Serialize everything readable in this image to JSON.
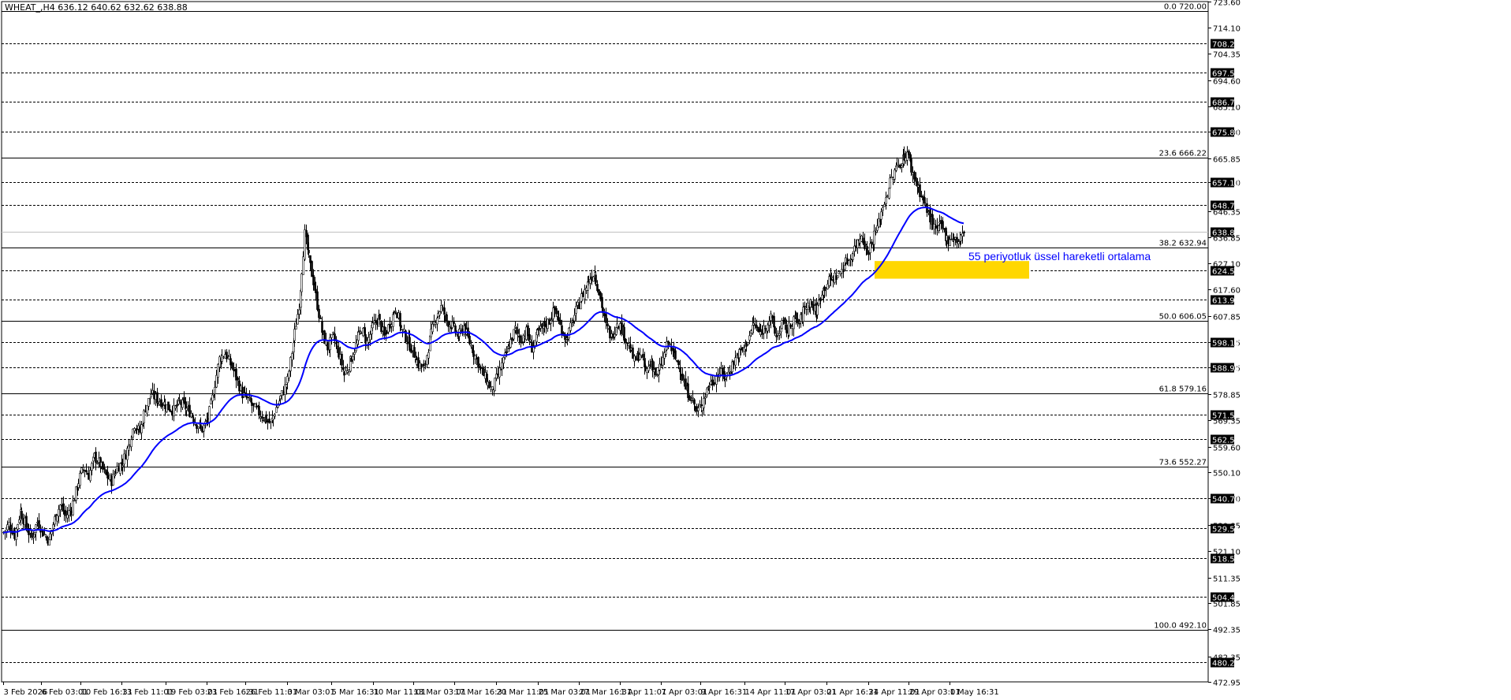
{
  "chart_data": {
    "type": "candlestick",
    "title": "WHEAT_,H4  636.12 640.62 632.62 638.88",
    "ylim": [
      472.95,
      723.6
    ],
    "y_ticks": [
      "723.60",
      "714.10",
      "704.35",
      "694.60",
      "685.10",
      "675.80",
      "665.85",
      "657.10",
      "646.35",
      "636.85",
      "627.10",
      "617.60",
      "607.85",
      "598.15",
      "588.95",
      "578.85",
      "569.35",
      "559.60",
      "550.10",
      "540.70",
      "530.85",
      "521.10",
      "511.35",
      "501.85",
      "492.35",
      "482.35",
      "472.95"
    ],
    "x_ticks": [
      "3 Feb 2026",
      "6 Feb 03:01",
      "10 Feb 16:31",
      "13 Feb 11:01",
      "19 Feb 03:01",
      "23 Feb 16:31",
      "26 Feb 11:01",
      "3 Mar 03:01",
      "5 Mar 16:31",
      "10 Mar 11:01",
      "13 Mar 03:01",
      "17 Mar 16:31",
      "20 Mar 11:01",
      "25 Mar 03:01",
      "27 Mar 16:31",
      "1 Apr 11:01",
      "7 Apr 03:01",
      "9 Apr 16:31",
      "14 Apr 11:01",
      "17 Apr 03:01",
      "21 Apr 16:31",
      "24 Apr 11:01",
      "29 Apr 03:01",
      "1 May 16:31"
    ],
    "horizontal_levels": [
      {
        "label": "708.20",
        "value": 708.2,
        "style": "dashed"
      },
      {
        "label": "697.50",
        "value": 697.5,
        "style": "dashed"
      },
      {
        "label": "686.75",
        "value": 686.75,
        "style": "dashed"
      },
      {
        "label": "675.80",
        "value": 675.8,
        "style": "dashed"
      },
      {
        "label": "657.10",
        "value": 657.1,
        "style": "dashed"
      },
      {
        "label": "648.75",
        "value": 648.75,
        "style": "dashed"
      },
      {
        "label": "638.88",
        "value": 638.88,
        "style": "solid"
      },
      {
        "label": "624.55",
        "value": 624.55,
        "style": "dashed"
      },
      {
        "label": "613.95",
        "value": 613.95,
        "style": "dashed"
      },
      {
        "label": "598.15",
        "value": 598.15,
        "style": "dashed"
      },
      {
        "label": "588.95",
        "value": 588.95,
        "style": "dashed"
      },
      {
        "label": "571.50",
        "value": 571.5,
        "style": "dashed"
      },
      {
        "label": "562.55",
        "value": 562.55,
        "style": "dashed"
      },
      {
        "label": "540.70",
        "value": 540.7,
        "style": "dashed"
      },
      {
        "label": "529.55",
        "value": 529.55,
        "style": "dashed"
      },
      {
        "label": "518.50",
        "value": 518.5,
        "style": "dashed"
      },
      {
        "label": "504.40",
        "value": 504.4,
        "style": "dashed"
      },
      {
        "label": "480.20",
        "value": 480.2,
        "style": "dashed"
      }
    ],
    "fib_levels": [
      {
        "label": "0.0 720.00",
        "value": 720.0
      },
      {
        "label": "23.6 666.22",
        "value": 666.22
      },
      {
        "label": "38.2 632.94",
        "value": 632.94
      },
      {
        "label": "50.0 606.05",
        "value": 606.05
      },
      {
        "label": "61.8 579.16",
        "value": 579.16
      },
      {
        "label": "73.6 552.27",
        "value": 552.27
      },
      {
        "label": "100.0 492.10",
        "value": 492.1
      }
    ],
    "ema_annotation": "55 periyotluk üssel hareketli ortalama",
    "ema_color": "#0000ff",
    "zone": {
      "from": 621.5,
      "to": 628.0,
      "color": "#ffd700"
    },
    "close_path": [
      [
        0,
        528
      ],
      [
        4,
        531
      ],
      [
        8,
        527
      ],
      [
        12,
        536
      ],
      [
        16,
        530
      ],
      [
        20,
        526
      ],
      [
        24,
        532
      ],
      [
        28,
        528
      ],
      [
        32,
        525
      ],
      [
        36,
        533
      ],
      [
        40,
        538
      ],
      [
        44,
        534
      ],
      [
        48,
        537
      ],
      [
        52,
        545
      ],
      [
        56,
        552
      ],
      [
        60,
        549
      ],
      [
        64,
        556
      ],
      [
        68,
        553
      ],
      [
        72,
        549
      ],
      [
        76,
        547
      ],
      [
        80,
        552
      ],
      [
        84,
        554
      ],
      [
        88,
        560
      ],
      [
        92,
        568
      ],
      [
        96,
        565
      ],
      [
        100,
        574
      ],
      [
        104,
        579
      ],
      [
        108,
        577
      ],
      [
        112,
        576
      ],
      [
        116,
        574
      ],
      [
        120,
        573
      ],
      [
        124,
        576
      ],
      [
        128,
        574
      ],
      [
        132,
        572
      ],
      [
        136,
        568
      ],
      [
        140,
        566
      ],
      [
        144,
        570
      ],
      [
        148,
        580
      ],
      [
        152,
        592
      ],
      [
        156,
        594
      ],
      [
        160,
        590
      ],
      [
        164,
        585
      ],
      [
        168,
        579
      ],
      [
        172,
        577
      ],
      [
        176,
        574
      ],
      [
        180,
        572
      ],
      [
        184,
        570
      ],
      [
        188,
        568
      ],
      [
        192,
        574
      ],
      [
        196,
        579
      ],
      [
        200,
        584
      ],
      [
        204,
        598
      ],
      [
        208,
        612
      ],
      [
        212,
        638
      ],
      [
        216,
        626
      ],
      [
        220,
        615
      ],
      [
        224,
        602
      ],
      [
        228,
        596
      ],
      [
        232,
        600
      ],
      [
        236,
        594
      ],
      [
        240,
        586
      ],
      [
        244,
        591
      ],
      [
        248,
        597
      ],
      [
        252,
        603
      ],
      [
        256,
        598
      ],
      [
        260,
        604
      ],
      [
        264,
        607
      ],
      [
        268,
        600
      ],
      [
        272,
        605
      ],
      [
        276,
        611
      ],
      [
        280,
        603
      ],
      [
        284,
        599
      ],
      [
        288,
        595
      ],
      [
        292,
        590
      ],
      [
        296,
        588
      ],
      [
        300,
        599
      ],
      [
        304,
        607
      ],
      [
        308,
        611
      ],
      [
        312,
        606
      ],
      [
        316,
        604
      ],
      [
        320,
        600
      ],
      [
        324,
        604
      ],
      [
        328,
        598
      ],
      [
        332,
        593
      ],
      [
        336,
        588
      ],
      [
        340,
        584
      ],
      [
        344,
        580
      ],
      [
        348,
        586
      ],
      [
        352,
        591
      ],
      [
        356,
        597
      ],
      [
        360,
        603
      ],
      [
        364,
        599
      ],
      [
        368,
        602
      ],
      [
        372,
        596
      ],
      [
        376,
        601
      ],
      [
        380,
        604
      ],
      [
        384,
        606
      ],
      [
        388,
        610
      ],
      [
        392,
        604
      ],
      [
        396,
        599
      ],
      [
        400,
        605
      ],
      [
        404,
        611
      ],
      [
        408,
        616
      ],
      [
        412,
        621
      ],
      [
        416,
        624
      ],
      [
        420,
        614
      ],
      [
        424,
        604
      ],
      [
        428,
        600
      ],
      [
        432,
        606
      ],
      [
        436,
        602
      ],
      [
        440,
        597
      ],
      [
        444,
        591
      ],
      [
        448,
        594
      ],
      [
        452,
        587
      ],
      [
        456,
        591
      ],
      [
        460,
        585
      ],
      [
        464,
        592
      ],
      [
        468,
        598
      ],
      [
        472,
        593
      ],
      [
        476,
        589
      ],
      [
        480,
        581
      ],
      [
        484,
        578
      ],
      [
        488,
        572
      ],
      [
        492,
        576
      ],
      [
        496,
        582
      ],
      [
        500,
        584
      ],
      [
        504,
        587
      ],
      [
        508,
        585
      ],
      [
        512,
        589
      ],
      [
        516,
        593
      ],
      [
        520,
        595
      ],
      [
        524,
        599
      ],
      [
        528,
        605
      ],
      [
        532,
        601
      ],
      [
        536,
        604
      ],
      [
        540,
        607
      ],
      [
        544,
        600
      ],
      [
        548,
        605
      ],
      [
        552,
        602
      ],
      [
        556,
        607
      ],
      [
        560,
        605
      ],
      [
        564,
        611
      ],
      [
        568,
        613
      ],
      [
        572,
        609
      ],
      [
        576,
        617
      ],
      [
        580,
        620
      ],
      [
        584,
        622
      ],
      [
        588,
        623
      ],
      [
        592,
        627
      ],
      [
        596,
        629
      ],
      [
        600,
        634
      ],
      [
        604,
        638
      ],
      [
        608,
        631
      ],
      [
        612,
        636
      ],
      [
        616,
        642
      ],
      [
        620,
        650
      ],
      [
        624,
        657
      ],
      [
        628,
        662
      ],
      [
        632,
        665
      ],
      [
        636,
        668
      ],
      [
        640,
        660
      ],
      [
        644,
        655
      ],
      [
        648,
        649
      ],
      [
        652,
        644
      ],
      [
        656,
        639
      ],
      [
        660,
        641
      ],
      [
        664,
        636
      ],
      [
        668,
        637
      ],
      [
        672,
        635
      ],
      [
        676,
        638
      ]
    ]
  }
}
